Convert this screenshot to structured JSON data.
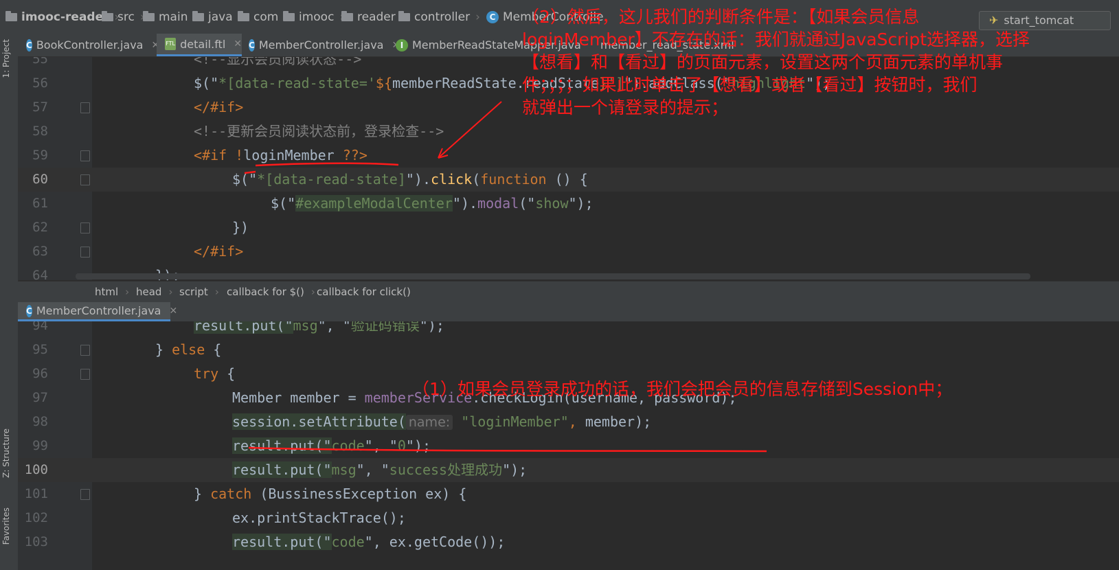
{
  "breadcrumb": [
    "imooc-reader",
    "src",
    "main",
    "java",
    "com",
    "imooc",
    "reader",
    "controller",
    "MemberControlle"
  ],
  "run_config": "start_tomcat",
  "tabs": [
    "BookController.java",
    "detail.ftl",
    "MemberController.java",
    "MemberReadStateMapper.java",
    "member_read_state.xml"
  ],
  "side_labels": {
    "project": "1: Project",
    "structure": "Z: Structure",
    "favorites": "Favorites"
  },
  "pane1": {
    "lines": [
      {
        "n": "55",
        "parts": [
          [
            "cm",
            "<!--显示会员阅读状态-->"
          ]
        ]
      },
      {
        "n": "56",
        "parts": [
          [
            "plain",
            "$(\""
          ],
          [
            "str",
            "*[data-read-state='"
          ],
          [
            "kw",
            "${"
          ],
          [
            "plain",
            "memberReadState.readState"
          ],
          [
            "kw",
            "}"
          ],
          [
            "str",
            "']"
          ],
          [
            "plain",
            "\").addClass(\""
          ],
          [
            "str",
            "highlight"
          ],
          [
            "plain",
            "\");"
          ]
        ]
      },
      {
        "n": "57",
        "parts": [
          [
            "kw",
            "</#if>"
          ]
        ]
      },
      {
        "n": "58",
        "parts": [
          [
            "cm",
            "<!--更新会员阅读状态前，登录检查-->"
          ]
        ]
      },
      {
        "n": "59",
        "parts": [
          [
            "kw",
            "<#if !"
          ],
          [
            "plain",
            "loginMember"
          ],
          [
            "kw",
            " ??>"
          ]
        ]
      },
      {
        "n": "60",
        "parts": [
          [
            "plain",
            "$(\""
          ],
          [
            "str",
            "*[data-read-state]"
          ],
          [
            "plain",
            "\")."
          ],
          [
            "fn",
            "click"
          ],
          [
            "plain",
            "("
          ],
          [
            "kw",
            "function"
          ],
          [
            "plain",
            " () {"
          ]
        ]
      },
      {
        "n": "61",
        "parts": [
          [
            "plain",
            "$(\""
          ],
          [
            "str",
            "#exampleModalCenter"
          ],
          [
            "plain",
            "\")."
          ],
          [
            "fm",
            "modal"
          ],
          [
            "plain",
            "(\""
          ],
          [
            "str",
            "show"
          ],
          [
            "plain",
            "\");"
          ]
        ]
      },
      {
        "n": "62",
        "parts": [
          [
            "plain",
            "})"
          ]
        ]
      },
      {
        "n": "63",
        "parts": [
          [
            "kw",
            "</#if>"
          ]
        ]
      },
      {
        "n": "64",
        "parts": [
          [
            "plain",
            "});"
          ]
        ]
      }
    ]
  },
  "path_bar": [
    "html",
    "head",
    "script",
    "callback for $()",
    "callback for click()"
  ],
  "pane2_tab": "MemberController.java",
  "pane2": {
    "lines": [
      {
        "n": "94",
        "parts": [
          [
            "plain",
            "result.put(\""
          ],
          [
            "str",
            "msg"
          ],
          [
            "plain",
            "\", \""
          ],
          [
            "str",
            "验证码错误"
          ],
          [
            "plain",
            "\");"
          ]
        ]
      },
      {
        "n": "95",
        "parts": [
          [
            "plain",
            "} "
          ],
          [
            "kw",
            "else"
          ],
          [
            "plain",
            " {"
          ]
        ]
      },
      {
        "n": "96",
        "parts": [
          [
            "kw",
            "try"
          ],
          [
            "plain",
            " {"
          ]
        ]
      },
      {
        "n": "97",
        "parts": [
          [
            "plain",
            "Member member = "
          ],
          [
            "fm",
            "memberService"
          ],
          [
            "plain",
            ".checkLogin(username, password);"
          ]
        ]
      },
      {
        "n": "98",
        "parts": [
          [
            "plain",
            "session.setAttribute("
          ],
          [
            "hint",
            "name:"
          ],
          [
            "str",
            " \"loginMember\""
          ],
          [
            "kw",
            ","
          ],
          [
            "plain",
            " member);"
          ]
        ]
      },
      {
        "n": "99",
        "parts": [
          [
            "plain",
            "result.put(\""
          ],
          [
            "str",
            "code"
          ],
          [
            "plain",
            "\", \""
          ],
          [
            "str",
            "0"
          ],
          [
            "plain",
            "\");"
          ]
        ]
      },
      {
        "n": "100",
        "parts": [
          [
            "plain",
            "result.put(\""
          ],
          [
            "str",
            "msg"
          ],
          [
            "plain",
            "\", \""
          ],
          [
            "str",
            "success处理成功"
          ],
          [
            "plain",
            "\");"
          ]
        ]
      },
      {
        "n": "101",
        "parts": [
          [
            "plain",
            "} "
          ],
          [
            "kw",
            "catch"
          ],
          [
            "plain",
            " (BussinessException ex) {"
          ]
        ]
      },
      {
        "n": "102",
        "parts": [
          [
            "plain",
            "ex.printStackTrace();"
          ]
        ]
      },
      {
        "n": "103",
        "parts": [
          [
            "plain",
            "result.put(\""
          ],
          [
            "str",
            "code"
          ],
          [
            "plain",
            "\", ex.getCode());"
          ]
        ]
      }
    ]
  },
  "annotations": {
    "top": [
      "（2）然后，这儿我们的判断条件是：【如果会员信息",
      "loginMember】不存在的话：我们就通过JavaScript选择器，选择",
      "【想看】和【看过】的页面元素，设置这两个页面元素的单机事",
      "件；；；；如果此时单击了【想看】或者【看过】按钮时，我们",
      "就弹出一个请登录的提示；"
    ],
    "bottom": "（1）如果会员登录成功的话，我们会把会员的信息存储到Session中；"
  },
  "colors": {
    "annotation": "#ff1a1a",
    "keyword": "#cc7832",
    "string": "#6a8759",
    "background": "#2b2b2b"
  }
}
